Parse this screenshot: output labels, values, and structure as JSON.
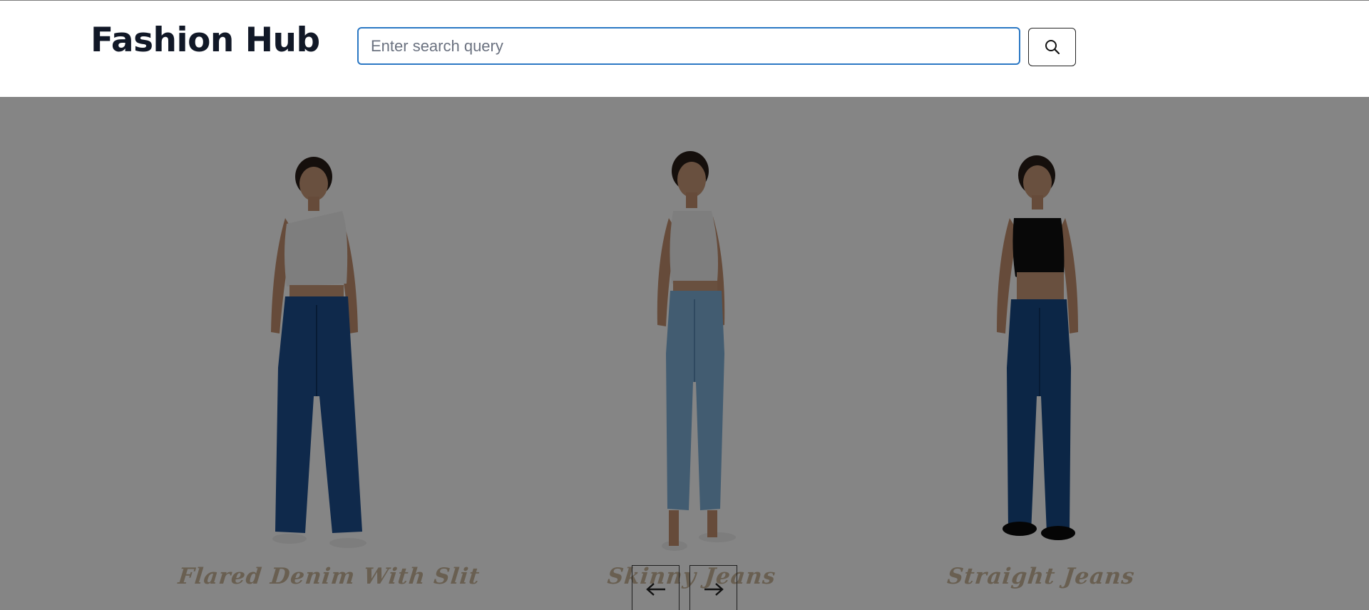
{
  "header": {
    "brand": "Fashion Hub",
    "search": {
      "placeholder": "Enter search query",
      "value": "",
      "button_icon": "search-icon"
    }
  },
  "carousel": {
    "items": [
      {
        "title": "Flared Denim With Slit",
        "top_color": "#f2f2f2",
        "jeans_color": "#1d4f91"
      },
      {
        "title": "Skinny Jeans",
        "top_color": "#f2f2f2",
        "jeans_color": "#7fb0d8"
      },
      {
        "title": "Straight Jeans",
        "top_color": "#111111",
        "jeans_color": "#174a86"
      }
    ],
    "prev_icon": "arrow-left-icon",
    "next_icon": "arrow-right-icon"
  },
  "colors": {
    "search_border": "#2b78c4",
    "overlay": "rgba(0,0,0,0.48)",
    "title_text": "#c9b79c",
    "brand_text": "#111827"
  }
}
